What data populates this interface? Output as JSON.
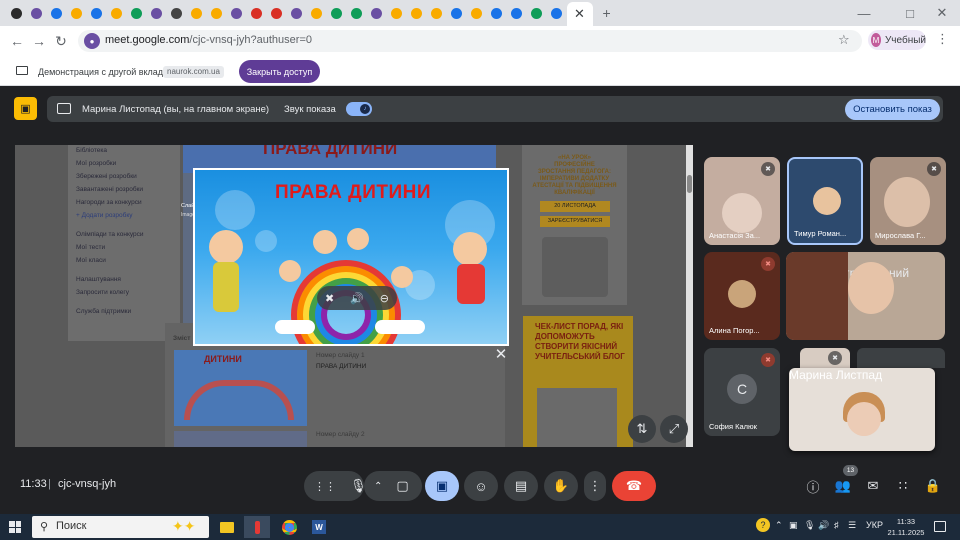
{
  "browser": {
    "favicon_colors": [
      "#2b2b2b",
      "#6a4fa3",
      "#1a73e8",
      "#f9ab00",
      "#1a73e8",
      "#f9ab00",
      "#0f9d58",
      "#6a4fa3",
      "#444",
      "#f9ab00",
      "#f9ab00",
      "#6a4fa3",
      "#d93025",
      "#d93025",
      "#6a4fa3",
      "#f9ab00",
      "#0f9d58",
      "#0f9d58",
      "#6a4fa3",
      "#f9ab00",
      "#f9ab00",
      "#f9ab00",
      "#1a73e8",
      "#f9ab00",
      "#1a73e8",
      "#1a73e8",
      "#0f9d58",
      "#1a73e8"
    ],
    "active_tab_icon": "close-icon",
    "new_tab": "+",
    "url_host": "meet.google.com",
    "url_path": "/cjc-vnsq-jyh?authuser=0",
    "profile_initial": "M",
    "profile_name": "Учебный"
  },
  "share_banner": {
    "text": "Демонстрация с другой вкладки:",
    "source": "naurok.com.ua",
    "stop_access": "Закрыть доступ"
  },
  "presenting_bar": {
    "presenter": "Марина Листопад (вы, на главном экране)",
    "sound_label": "Звук показа",
    "stop_button": "Остановить показ"
  },
  "shared_page": {
    "hero_title": "ПРАВА ДИТИНИ",
    "sidebar_items": [
      "Бібліотека",
      "Мої розробки",
      "Збережені розробки",
      "Завантажені розробки",
      "Нагороди за конкурси",
      "+ Додати розробку",
      "Олімпіади та конкурси",
      "Мої тести",
      "Мої класи",
      "Налаштування",
      "Запросити колегу",
      "Служба підтримки"
    ],
    "section_label": "Зміст",
    "slide_label": "Слайд №1",
    "slide_sub": "Image 1 of 44",
    "thumb_title": "ДИТИНИ",
    "item1_label": "Номер слайду 1",
    "item1_title": "ПРАВА ДИТИНИ",
    "item2_label": "Номер слайду 2",
    "ad1_lines": [
      "«НА УРОК»",
      "ПРОФЕСІЙНЕ",
      "ЗРОСТАННЯ ПЕДАГОГА:",
      "ІМПЕРАТИВИ ДОДАТКУ",
      "АТЕСТАЦІЇ ТА ПІДВИЩЕННЯ",
      "КВАЛІФІКАЦІЇ"
    ],
    "ad1_date": "20 ЛИСТОПАДА",
    "ad1_register": "ЗАРЕЄСТРУВАТИСЯ",
    "ad2_title": "ЧЕК-ЛИСТ ПОРАД, ЯКІ ДОПОМОЖУТЬ СТВОРИТИ ЯКІСНИЙ УЧИТЕЛЬСЬКИЙ БЛОГ"
  },
  "popup": {
    "title": "ПРАВА ДИТИНИ",
    "controls": [
      "pin-off-icon",
      "volume-icon",
      "remove-icon"
    ]
  },
  "participants": [
    {
      "name": "Анастасія За...",
      "muted": true
    },
    {
      "name": "Тимур Роман...",
      "muted": false
    },
    {
      "name": "Мирослава Г...",
      "muted": true
    },
    {
      "name": "Алина Погор...",
      "muted": true
    },
    {
      "name": "Данило Загребельний",
      "muted": true
    },
    {
      "name": "София Калюк",
      "muted": true,
      "initial": "С"
    },
    {
      "name": "Марина Листпад",
      "muted": false
    }
  ],
  "meeting": {
    "time": "11:33",
    "code": "cjc-vnsq-jyh",
    "people_count": "13"
  },
  "taskbar": {
    "search_placeholder": "Поиск",
    "lang": "УКР",
    "time": "11:33",
    "date": "21.11.2025"
  }
}
